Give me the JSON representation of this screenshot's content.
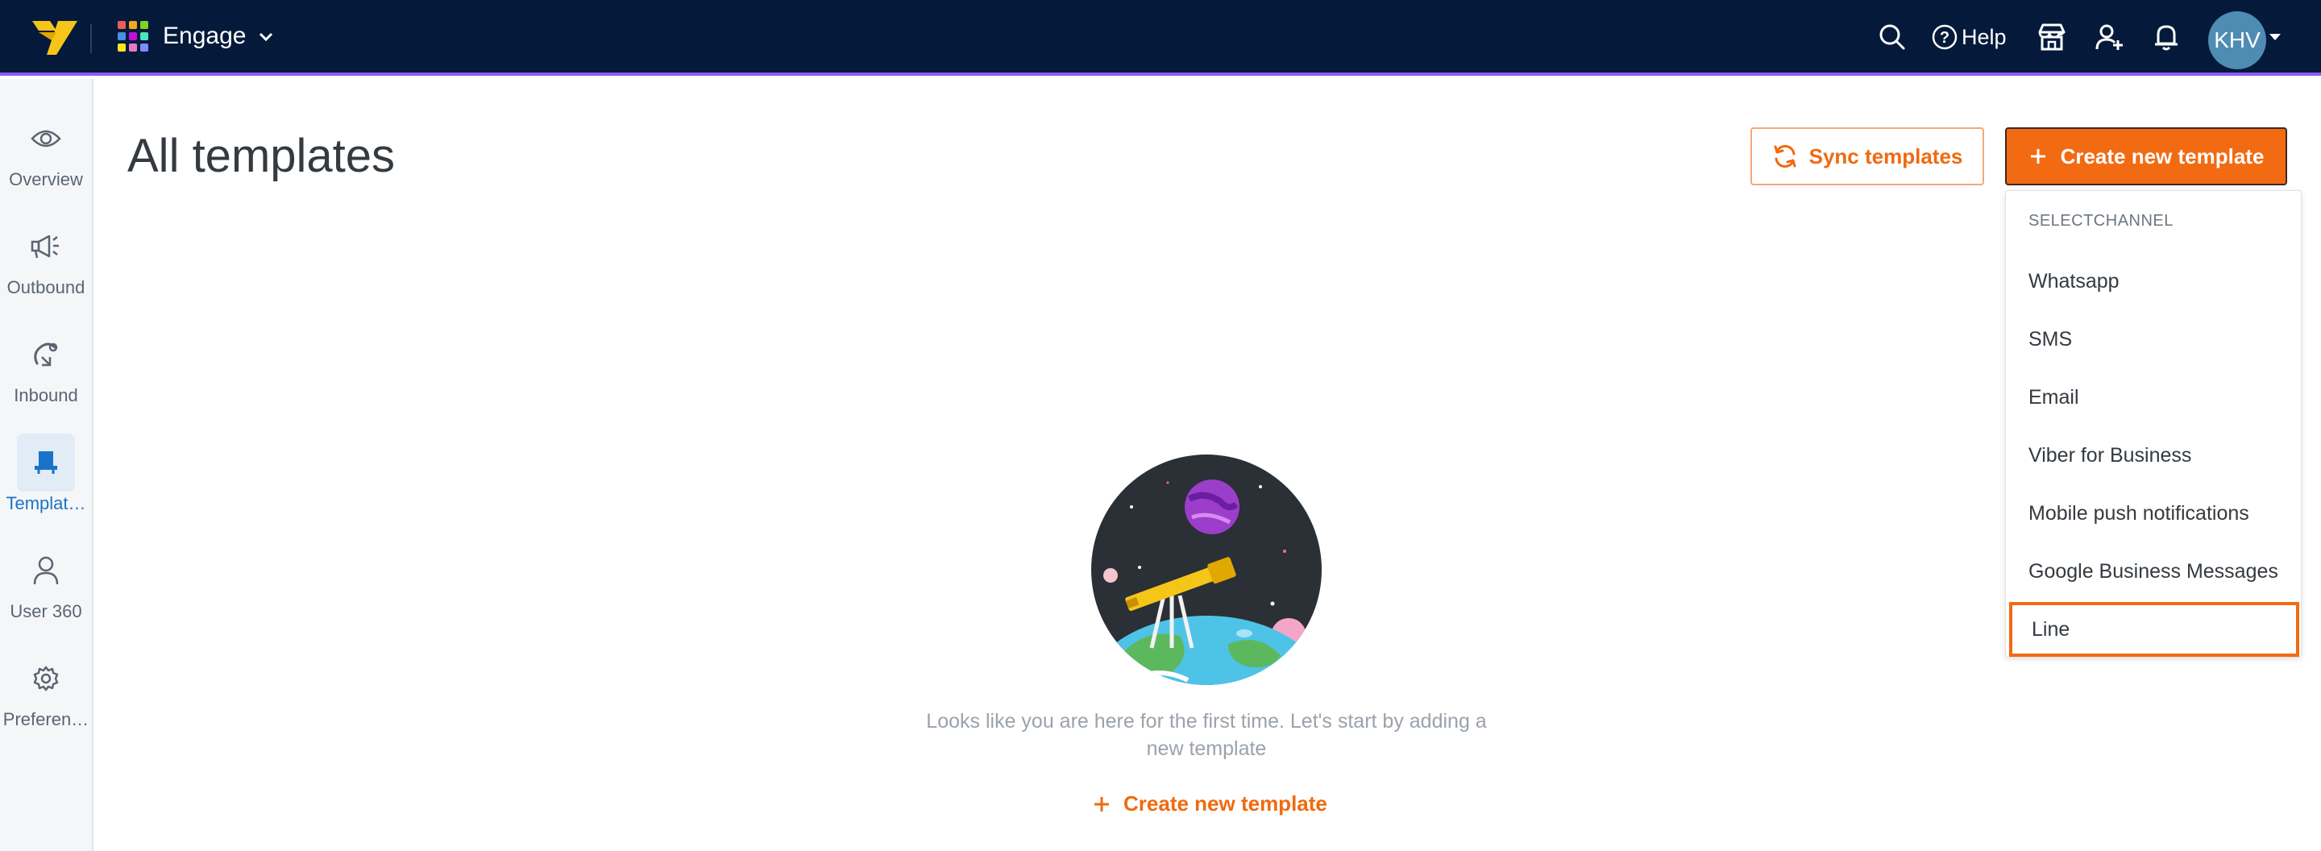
{
  "app": {
    "name": "Engage",
    "grid_colors": [
      "#f05a5a",
      "#f5a623",
      "#7ed321",
      "#4a90e2",
      "#bd10e0",
      "#50e3c2",
      "#f8e71c",
      "#e67ac7",
      "#7b8cff"
    ]
  },
  "topbar": {
    "help_label": "Help",
    "avatar_initials": "KHV",
    "icons": [
      "search-icon",
      "help-icon",
      "store-icon",
      "add-user-icon",
      "bell-icon"
    ]
  },
  "sidebar": {
    "items": [
      {
        "label": "Overview",
        "icon": "eye-icon"
      },
      {
        "label": "Outbound",
        "icon": "megaphone-icon"
      },
      {
        "label": "Inbound",
        "icon": "inbound-icon"
      },
      {
        "label": "Templat…",
        "icon": "template-icon",
        "active": true
      },
      {
        "label": "User 360",
        "icon": "user-icon"
      },
      {
        "label": "Preferen…",
        "icon": "gear-icon"
      }
    ]
  },
  "main": {
    "title": "All templates",
    "sync_label": "Sync templates",
    "create_label": "Create new template",
    "empty_text": "Looks like you are here for the first time. Let's start by adding a new template",
    "empty_create_label": "Create new template"
  },
  "dropdown": {
    "header": "SELECTCHANNEL",
    "items": [
      "Whatsapp",
      "SMS",
      "Email",
      "Viber for Business",
      "Mobile push notifications",
      "Google Business Messages",
      "Line"
    ],
    "highlighted": "Line"
  },
  "colors": {
    "topbar_bg": "#051a3a",
    "accent_orange": "#f26a12",
    "active_blue": "#1a73c9",
    "purple_line": "#8a5cf6"
  }
}
